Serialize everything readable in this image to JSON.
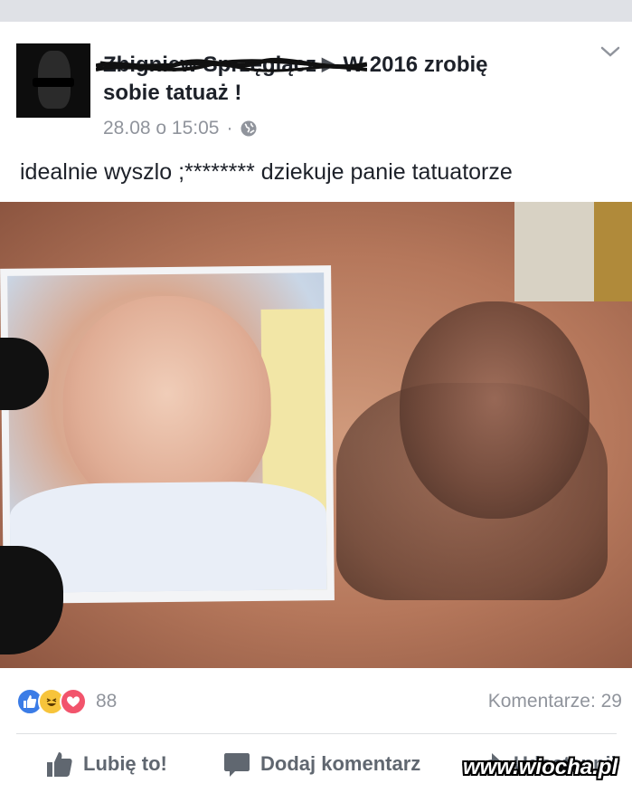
{
  "post": {
    "author": "Zbigniew Sprzęgiącz",
    "arrow": "▶",
    "group_line1": "W 2016 zrobię",
    "group_line2": "sobie tatuaż !",
    "timestamp": "28.08 o 15:05",
    "separator": "·",
    "privacy_icon": "globe-icon",
    "message": "idealnie wyszlo ;******** dziekuje panie tatuatorze"
  },
  "stats": {
    "reactions": [
      "like-icon",
      "haha-icon",
      "love-icon"
    ],
    "reaction_count": "88",
    "comments": "Komentarze: 29"
  },
  "actions": {
    "like": "Lubię to!",
    "comment": "Dodaj komentarz",
    "share": "Udostępnij"
  },
  "watermark": "www.wiocha.pl",
  "colors": {
    "like_blue": "#3b7ce6",
    "haha_yellow": "#f7c43b",
    "love_red": "#f2546c",
    "meta_gray": "#90949c",
    "action_gray": "#606770"
  }
}
